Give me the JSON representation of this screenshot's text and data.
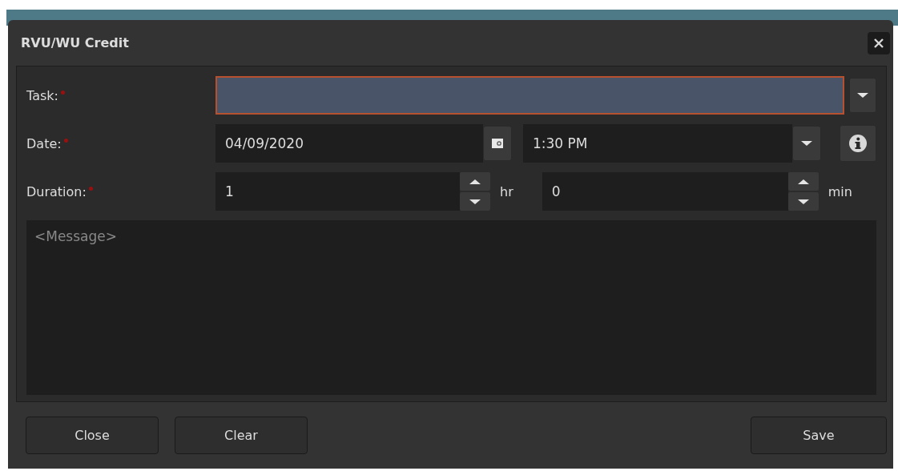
{
  "window": {
    "title": "RVU/WU Credit"
  },
  "task": {
    "label": "Task:",
    "required": true,
    "invalid": true
  },
  "date": {
    "label": "Date:",
    "required": true,
    "value": "04/09/2020",
    "time": "1:30 PM"
  },
  "duration": {
    "label": "Duration:",
    "required": true,
    "hours": "1",
    "hours_unit": "hr",
    "minutes": "0",
    "minutes_unit": "min"
  },
  "message": {
    "placeholder": "<Message>"
  },
  "left_buttons": [
    "Close",
    "Clear"
  ],
  "right_buttons": [
    "Save"
  ]
}
